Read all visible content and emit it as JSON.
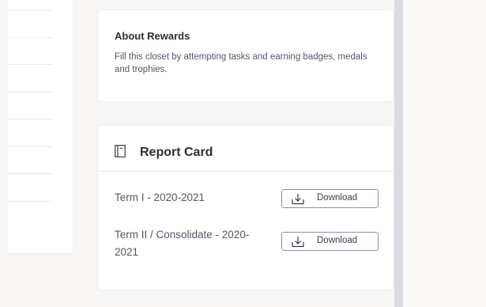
{
  "about": {
    "title": "About Rewards",
    "description": "Fill this closet by attempting tasks and earning badges, medals and trophies."
  },
  "report_card": {
    "title": "Report Card",
    "icon": "report-card-icon",
    "terms": [
      {
        "label": "Term I - 2020-2021",
        "button_label": "Download",
        "button_icon": "download-icon"
      },
      {
        "label": "Term II / Consolidate - 2020-2021",
        "button_label": "Download",
        "button_icon": "download-icon"
      }
    ]
  },
  "colors": {
    "page_bg": "#f8f6f5",
    "card_bg": "#ffffff",
    "border": "#ececf1",
    "button_border": "#8a8fb0",
    "scrollbar": "#dcdbe2"
  }
}
